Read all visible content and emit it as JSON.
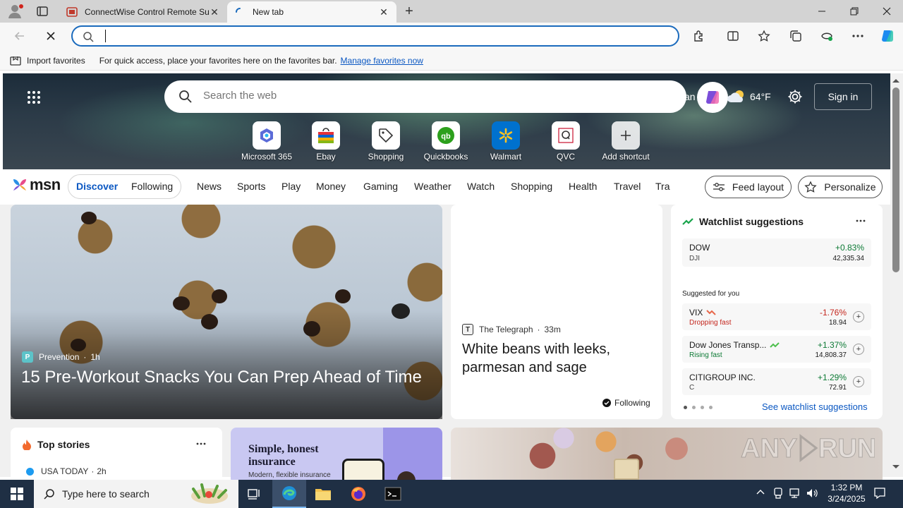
{
  "tabs": [
    {
      "title": "ConnectWise Control Remote Su",
      "active": false
    },
    {
      "title": "New tab",
      "active": true
    }
  ],
  "address": {
    "value": "",
    "placeholder": ""
  },
  "favorites_bar": {
    "import_label": "Import favorites",
    "message": "For quick access, place your favorites here on the favorites bar.",
    "manage_link": "Manage favorites now"
  },
  "hero": {
    "search_placeholder": "Search the web",
    "weather_partial": "an",
    "temperature": "64°F",
    "sign_in": "Sign in",
    "shortcuts": [
      {
        "label": "Microsoft 365",
        "icon": "microsoft-365-icon"
      },
      {
        "label": "Ebay",
        "icon": "ebay-icon"
      },
      {
        "label": "Shopping",
        "icon": "shopping-tag-icon"
      },
      {
        "label": "Quickbooks",
        "icon": "quickbooks-icon"
      },
      {
        "label": "Walmart",
        "icon": "walmart-icon"
      },
      {
        "label": "QVC",
        "icon": "qvc-icon"
      },
      {
        "label": "Add shortcut",
        "icon": "plus-icon"
      }
    ]
  },
  "msn_nav": {
    "logo": "msn",
    "discover": "Discover",
    "following": "Following",
    "items": [
      "News",
      "Sports",
      "Play",
      "Money",
      "Gaming",
      "Weather",
      "Watch",
      "Shopping",
      "Health",
      "Travel",
      "Trai"
    ],
    "feed_layout": "Feed layout",
    "personalize": "Personalize"
  },
  "feature_card": {
    "source": "Prevention",
    "age": "1h",
    "headline": "15 Pre-Workout Snacks You Can Prep Ahead of Time"
  },
  "telegraph_card": {
    "source": "The Telegraph",
    "age": "33m",
    "headline": "White beans with leeks, parmesan and sage",
    "following": "Following"
  },
  "watchlist": {
    "title": "Watchlist suggestions",
    "main": {
      "name": "DOW",
      "symbol": "DJI",
      "change": "+0.83%",
      "price": "42,335.34"
    },
    "suggested_label": "Suggested for you",
    "items": [
      {
        "name": "VIX",
        "status": "Dropping fast",
        "change": "-1.76%",
        "price": "18.94",
        "trend": "down"
      },
      {
        "name": "Dow Jones Transp...",
        "status": "Rising fast",
        "change": "+1.37%",
        "price": "14,808.37",
        "trend": "up"
      },
      {
        "name": "CITIGROUP INC.",
        "status": "C",
        "change": "+1.29%",
        "price": "72.91",
        "trend": "up"
      }
    ],
    "see_more": "See watchlist suggestions"
  },
  "top_stories": {
    "title": "Top stories",
    "first_source": "USA TODAY",
    "first_age": "2h"
  },
  "ad_card": {
    "headline": "Simple, honest insurance",
    "subline": "Modern, flexible insurance"
  },
  "taskbar": {
    "search_placeholder": "Type here to search",
    "time": "1:32 PM",
    "date": "3/24/2025"
  },
  "colors": {
    "accent": "#0a57c2",
    "address_border": "#1b6bbd",
    "taskbar": "#1f2f44",
    "positive": "#0d7a35",
    "negative": "#c4261d"
  }
}
